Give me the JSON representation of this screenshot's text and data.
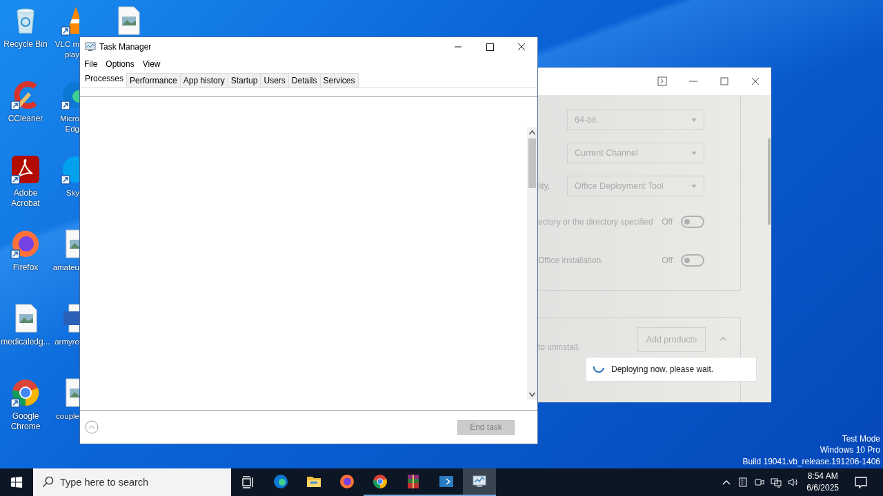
{
  "desktop_icons": [
    [
      {
        "kind": "recycle-bin",
        "label": "Recycle Bin",
        "shortcut": false
      },
      {
        "kind": "ccleaner",
        "label": "CCleaner",
        "shortcut": true
      },
      {
        "kind": "acrobat",
        "label": "Adobe Acrobat",
        "shortcut": true
      },
      {
        "kind": "firefox",
        "label": "Firefox",
        "shortcut": true
      },
      {
        "kind": "image-file",
        "label": "medicaledg...",
        "shortcut": false
      },
      {
        "kind": "chrome",
        "label": "Google Chrome",
        "shortcut": true
      }
    ],
    [
      {
        "kind": "vlc",
        "label": "VLC m play",
        "shortcut": true
      },
      {
        "kind": "edge",
        "label": "Micro Edg",
        "shortcut": true
      },
      {
        "kind": "skype",
        "label": "Sky",
        "shortcut": true
      },
      {
        "kind": "image-file",
        "label": "amateu",
        "shortcut": false
      },
      {
        "kind": "word",
        "label": "armyre",
        "shortcut": false
      },
      {
        "kind": "image-file",
        "label": "couple",
        "shortcut": false
      }
    ],
    [
      {
        "kind": "image-file",
        "shortcut": false
      }
    ]
  ],
  "installer_window": {
    "rows": [
      {
        "kind": "dropdown",
        "value": "64-bit"
      },
      {
        "kind": "dropdown",
        "value": "Current Channel"
      },
      {
        "kind": "dropdown",
        "label": "lity,",
        "value": "Office Deployment Tool"
      },
      {
        "kind": "toggle",
        "label": "ectory or the directory specified",
        "state": "Off",
        "on": false
      },
      {
        "kind": "toggle",
        "label": "Office installation.",
        "state": "Off",
        "on": false
      }
    ],
    "products_text": "to uninstall.",
    "add_button": "Add products",
    "toast": "Deploying now, please wait."
  },
  "task_manager": {
    "title": "Task Manager",
    "menu": [
      "File",
      "Options",
      "View"
    ],
    "tabs": [
      {
        "label": "Processes",
        "selected": true
      },
      {
        "label": "Performance",
        "selected": false
      },
      {
        "label": "App history",
        "selected": false
      },
      {
        "label": "Startup",
        "selected": false
      },
      {
        "label": "Users",
        "selected": false
      },
      {
        "label": "Details",
        "selected": false
      },
      {
        "label": "Services",
        "selected": false
      }
    ],
    "end_task": {
      "label": "End task",
      "disabled": true
    }
  },
  "os_info": [
    "Test Mode",
    "Windows 10 Pro",
    "Build 19041.vb_release.191206-1406"
  ],
  "taskbar": {
    "search_placeholder": "Type here to search",
    "apps": [
      {
        "kind": "edge",
        "running": false,
        "selected": false
      },
      {
        "kind": "explorer",
        "running": false,
        "selected": false
      },
      {
        "kind": "firefox",
        "running": false,
        "selected": false
      },
      {
        "kind": "chrome",
        "running": true,
        "selected": false
      },
      {
        "kind": "winrar",
        "running": true,
        "selected": false
      },
      {
        "kind": "console",
        "running": true,
        "selected": false
      },
      {
        "kind": "task-manager",
        "running": true,
        "selected": true
      }
    ],
    "time": "8:54 AM",
    "date": "6/6/2025"
  }
}
